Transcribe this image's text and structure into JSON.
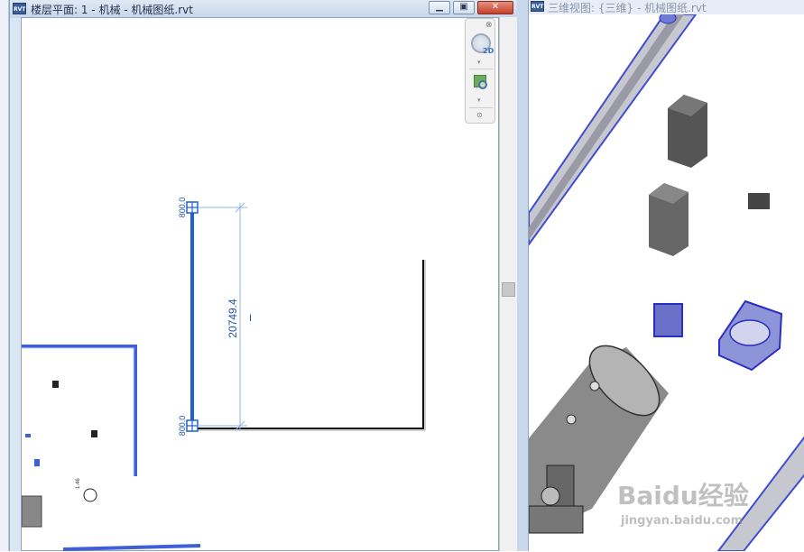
{
  "left_window": {
    "icon_label": "RVT",
    "title": "楼层平面: 1 - 机械 - 机械图纸.rvt",
    "buttons": {
      "minimize": "▁",
      "restore": "▣",
      "close": "✕"
    }
  },
  "right_window": {
    "icon_label": "RVT",
    "title": "三维视图: {三维} - 机械图纸.rvt"
  },
  "navigation_bar": {
    "close_glyph": "⊗",
    "badge_2d": "2D",
    "dropdown_glyph": "▾",
    "footer_glyph": "⊙"
  },
  "drawing": {
    "dimension_value": "20749.4",
    "level_top": "800.0",
    "level_bottom": "800.0",
    "small_label": "1.46",
    "dim_symbol": "I"
  },
  "colors": {
    "selection_blue": "#1f5fd6",
    "dimension_blue": "#6ea0e0",
    "wall_black": "#111111",
    "pipe_blue": "#3f5fd8"
  },
  "watermark": {
    "logo": "Baidu经验",
    "url": "jingyan.baidu.com"
  }
}
